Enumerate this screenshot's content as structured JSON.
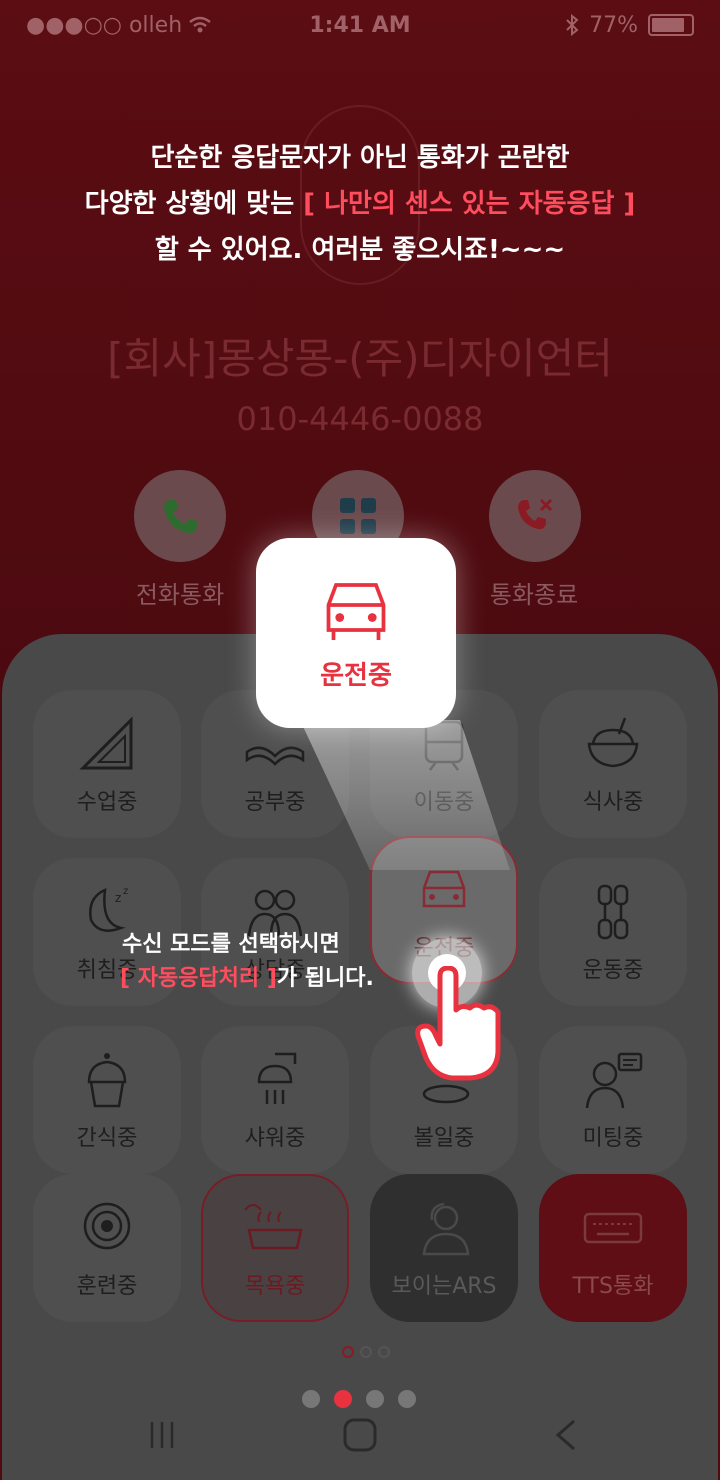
{
  "status_bar": {
    "carrier": "●●●○○ olleh",
    "time": "1:41 AM",
    "battery": "77%"
  },
  "intro": {
    "line1": "단순한 응답문자가 아닌 통화가 곤란한",
    "line2_prefix": "다양한 상황에 맞는 ",
    "line2_highlight": "[ 나만의 센스 있는 자동응답 ]",
    "line3": "할 수 있어요. 여러분 좋으시죠!~~~"
  },
  "caller": {
    "name": "[회사]몽상몽-(주)디자이언터",
    "number": "010-4446-0088"
  },
  "call_actions": {
    "answer_label": "전화통화",
    "end_label": "통화종료"
  },
  "popup": {
    "label": "운전중"
  },
  "modes": [
    {
      "label": "수업중",
      "icon": "triangle-ruler-icon"
    },
    {
      "label": "공부중",
      "icon": "open-book-icon"
    },
    {
      "label": "이동중",
      "icon": "train-icon"
    },
    {
      "label": "식사중",
      "icon": "rice-bowl-icon"
    },
    {
      "label": "취침중",
      "icon": "moon-sleep-icon"
    },
    {
      "label": "상담중",
      "icon": "two-people-icon"
    },
    {
      "label": "운전중",
      "icon": "car-icon"
    },
    {
      "label": "운동중",
      "icon": "dumbbell-icon"
    },
    {
      "label": "간식중",
      "icon": "cupcake-icon"
    },
    {
      "label": "샤워중",
      "icon": "shower-icon"
    },
    {
      "label": "볼일중",
      "icon": "toilet-icon"
    },
    {
      "label": "미팅중",
      "icon": "meeting-icon"
    },
    {
      "label": "훈련중",
      "icon": "target-icon"
    },
    {
      "label": "목욕중",
      "icon": "bathtub-icon"
    },
    {
      "label": "보이는ARS",
      "icon": "agent-icon"
    },
    {
      "label": "TTS통화",
      "icon": "keyboard-icon"
    }
  ],
  "guide": {
    "line1": "수신 모드를 선택하시면",
    "line2_highlight": "[ 자동응답처리 ]",
    "line2_suffix": "가 됩니다."
  },
  "pagination": {
    "sheet_pages": 3,
    "sheet_current": 1,
    "tour_pages": 4,
    "tour_current": 2
  },
  "colors": {
    "accent": "#e8323f",
    "background": "#4f0b10",
    "sheet": "#494949"
  }
}
